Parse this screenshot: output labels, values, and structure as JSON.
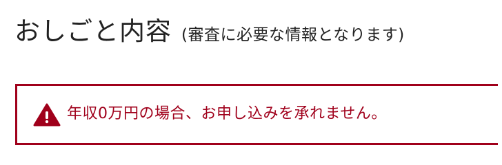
{
  "section": {
    "title": "おしごと内容",
    "subtitle": "(審査に必要な情報となります)"
  },
  "alert": {
    "icon": "warning-triangle-icon",
    "message": "年収0万円の場合、お申し込みを承れません。",
    "color": "#a0001b"
  }
}
